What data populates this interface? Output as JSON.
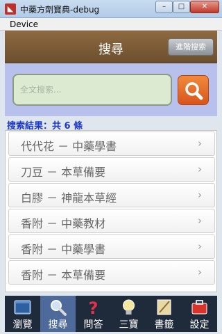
{
  "window": {
    "title": "中藥方劑寶典-debug",
    "menu_device": "Device",
    "min": "–",
    "max": "□",
    "close": "✕"
  },
  "header": {
    "title": "搜尋",
    "advanced_button": "進階搜索"
  },
  "search": {
    "placeholder": "全文搜索..."
  },
  "results": {
    "summary": "搜索結果：共 6 條",
    "items": [
      {
        "label": "代代花 － 中藥學書"
      },
      {
        "label": "刀豆 － 本草備要"
      },
      {
        "label": "白膠 － 神龍本草經"
      },
      {
        "label": "香附 － 中藥教材"
      },
      {
        "label": "香附 － 中藥學書"
      },
      {
        "label": "香附 － 本草備要"
      }
    ]
  },
  "tabs": [
    {
      "label": "瀏覽",
      "icon": "browse-icon"
    },
    {
      "label": "搜尋",
      "icon": "magnifier-icon",
      "active": true
    },
    {
      "label": "問答",
      "icon": "question-icon"
    },
    {
      "label": "三寶",
      "icon": "lightbulb-icon"
    },
    {
      "label": "書籤",
      "icon": "bookmark-icon"
    },
    {
      "label": "設定",
      "icon": "toolbox-icon"
    }
  ],
  "colors": {
    "header": "#7a5a36",
    "accent_search": "#e36d2b",
    "result_count": "#1b37c8",
    "tabbar": "#1f2a3b"
  }
}
